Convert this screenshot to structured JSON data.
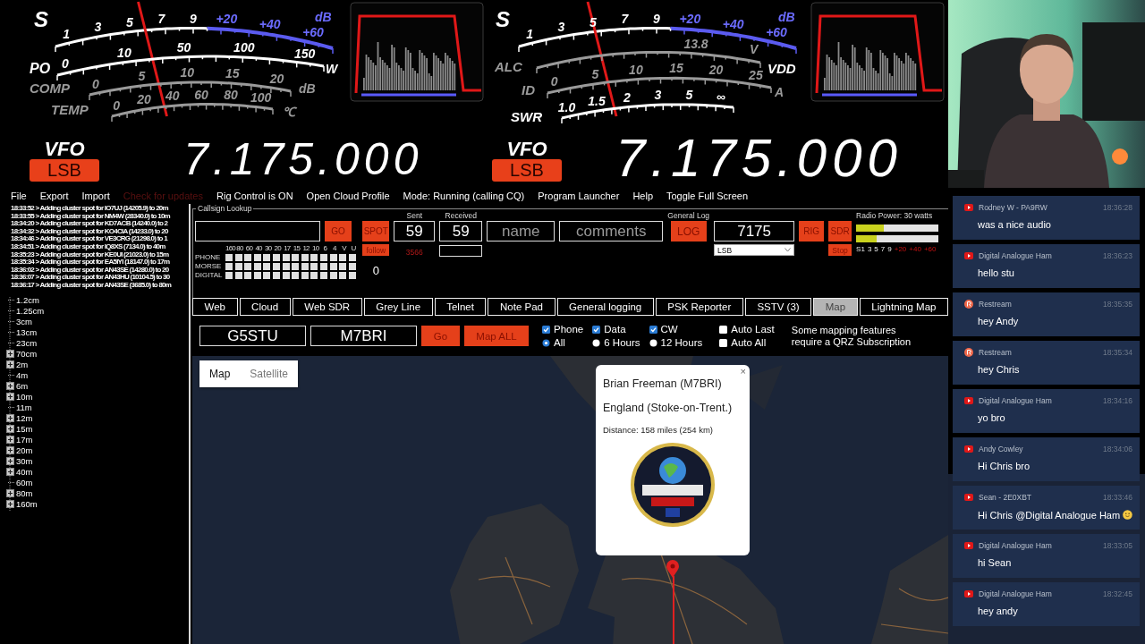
{
  "meters": [
    {
      "level": 0.35,
      "rows": [
        {
          "label": "S",
          "kind": "bright",
          "ticks": [
            "1",
            "3",
            "5",
            "7",
            "9"
          ],
          "over_ticks": [
            "+20",
            "+40",
            "+60"
          ],
          "unit": "dB"
        },
        {
          "label": "PO",
          "kind": "bright",
          "ticks": [
            "0",
            "10",
            "50",
            "100",
            "150"
          ],
          "unit": "W"
        },
        {
          "label": "COMP",
          "kind": "dim",
          "ticks": [
            "0",
            "5",
            "10",
            "15",
            "20"
          ],
          "unit": "dB"
        },
        {
          "label": "TEMP",
          "kind": "dim",
          "ticks": [
            "0",
            "20",
            "40",
            "60",
            "80",
            "100"
          ],
          "unit": "℃"
        }
      ]
    },
    {
      "level": 0.3,
      "rows": [
        {
          "label": "S",
          "kind": "bright",
          "ticks": [
            "1",
            "3",
            "5",
            "7",
            "9"
          ],
          "over_ticks": [
            "+20",
            "+40",
            "+60"
          ],
          "unit": "dB"
        },
        {
          "label": "ALC",
          "kind": "dim",
          "ticks": [
            "13.8"
          ],
          "unit": "V",
          "end_label": "VDD"
        },
        {
          "label": "ID",
          "kind": "dim",
          "ticks": [
            "0",
            "5",
            "10",
            "15",
            "20",
            "25"
          ],
          "unit": "A"
        },
        {
          "label": "SWR",
          "kind": "bright",
          "ticks": [
            "1.0",
            "1.5",
            "2",
            "3",
            "5",
            "∞"
          ]
        }
      ]
    }
  ],
  "vfos": [
    {
      "label": "VFO",
      "mode": "LSB",
      "frequency": "7.175.000",
      "active": false
    },
    {
      "label": "VFO",
      "mode": "LSB",
      "frequency": "7.175.000",
      "active": true
    }
  ],
  "menu": [
    {
      "label": "File",
      "disabled": false
    },
    {
      "label": "Export",
      "disabled": false
    },
    {
      "label": "Import",
      "disabled": false
    },
    {
      "label": "Check for updates",
      "disabled": true
    },
    {
      "label": "Rig Control is ON",
      "disabled": false
    },
    {
      "label": "Open Cloud Profile",
      "disabled": false
    },
    {
      "label": "Mode: Running (calling CQ)",
      "disabled": false
    },
    {
      "label": "Program Launcher",
      "disabled": false
    },
    {
      "label": "Help",
      "disabled": false
    },
    {
      "label": "Toggle Full Screen",
      "disabled": false
    }
  ],
  "cluster_log": [
    "18:33:52 > Adding cluster spot for IO7UJ (14205.9) to 20m",
    "18:33:55 > Adding cluster spot for NM4W (28340.0) to 10m",
    "18:34:20 > Adding cluster spot for KD7ACB (14240.0) to 2",
    "18:34:32 > Adding cluster spot for KO4CIA (14233.0) to 20",
    "18:34:46 > Adding cluster spot for VE3CRG (21298.0) to 1",
    "18:34:51 > Adding cluster spot for IQ8XS (7134.0) to 40m",
    "18:35:23 > Adding cluster spot for KE0UI (21023.0) to 15m",
    "18:35:34 > Adding cluster spot for EA5IYI (18147.0) to 17m",
    "18:36:02 > Adding cluster spot for AN43SE (14280.0) to 20",
    "18:36:07 > Adding cluster spot for AN43HU (10104.5) to 30",
    "18:36:17 > Adding cluster spot for AN43SE (3685.0) to 80m"
  ],
  "lookup": {
    "title": "Callsign Lookup",
    "go": "GO",
    "spot": "SPOT",
    "follow": "follow",
    "count": "3566",
    "qso_count": "0",
    "bands": [
      "160",
      "80",
      "60",
      "40",
      "30",
      "20",
      "17",
      "15",
      "12",
      "10",
      "6",
      "4",
      "V",
      "U"
    ],
    "modes": [
      {
        "label": "PHONE",
        "cells": [
          {
            "checked": false
          },
          {
            "checked": false
          },
          {
            "checked": false
          },
          {
            "checked": false
          },
          {
            "checked": false
          },
          {
            "checked": false
          },
          {
            "checked": false
          },
          {
            "checked": false
          },
          {
            "checked": false
          },
          {
            "checked": false
          },
          {
            "checked": false
          },
          {
            "checked": false
          },
          {
            "checked": false
          },
          {
            "checked": false
          }
        ]
      },
      {
        "label": "MORSE",
        "cells": [
          {
            "checked": false
          },
          {
            "checked": false
          },
          {
            "checked": false
          },
          {
            "checked": false
          },
          {
            "checked": false
          },
          {
            "checked": false
          },
          {
            "checked": false
          },
          {
            "checked": false
          },
          {
            "checked": false
          },
          {
            "checked": false
          },
          {
            "checked": false
          },
          {
            "checked": false
          },
          {
            "checked": false
          },
          {
            "checked": false
          }
        ]
      },
      {
        "label": "DIGITAL",
        "cells": [
          {
            "checked": false
          },
          {
            "checked": false
          },
          {
            "checked": false
          },
          {
            "checked": false
          },
          {
            "checked": false
          },
          {
            "checked": false
          },
          {
            "checked": false
          },
          {
            "checked": false
          },
          {
            "checked": false
          },
          {
            "checked": false
          },
          {
            "checked": false
          },
          {
            "checked": false
          },
          {
            "checked": false
          },
          {
            "checked": false
          }
        ]
      }
    ],
    "sent_label": "Sent",
    "sent": "59",
    "received_label": "Received",
    "received": "59",
    "name_placeholder": "name",
    "comments_placeholder": "comments",
    "log_title": "General Log",
    "log": "LOG",
    "frequency": "7175",
    "mode": "LSB",
    "rig": "RIG",
    "sdr": "SDR",
    "stop": "Stop",
    "power_label": "Radio Power: 30 watts",
    "power_bars": [
      {
        "level": 0.34
      },
      {
        "level": 0.25
      }
    ],
    "power_scale": [
      {
        "label": "S1",
        "kind": "normal"
      },
      {
        "label": "3",
        "kind": "normal"
      },
      {
        "label": "5",
        "kind": "normal"
      },
      {
        "label": "7",
        "kind": "normal"
      },
      {
        "label": "9",
        "kind": "normal"
      },
      {
        "label": "+20",
        "kind": "over"
      },
      {
        "label": "+40",
        "kind": "over"
      },
      {
        "label": "+60",
        "kind": "over"
      }
    ]
  },
  "band_tree": [
    {
      "label": "1.2cm",
      "kind": "leaf"
    },
    {
      "label": "1.25cm",
      "kind": "leaf"
    },
    {
      "label": "3cm",
      "kind": "leaf"
    },
    {
      "label": "13cm",
      "kind": "leaf"
    },
    {
      "label": "23cm",
      "kind": "leaf"
    },
    {
      "label": "70cm",
      "kind": "group"
    },
    {
      "label": "2m",
      "kind": "group"
    },
    {
      "label": "4m",
      "kind": "leaf"
    },
    {
      "label": "6m",
      "kind": "group"
    },
    {
      "label": "10m",
      "kind": "group"
    },
    {
      "label": "11m",
      "kind": "leaf"
    },
    {
      "label": "12m",
      "kind": "group"
    },
    {
      "label": "15m",
      "kind": "group"
    },
    {
      "label": "17m",
      "kind": "group"
    },
    {
      "label": "20m",
      "kind": "group"
    },
    {
      "label": "30m",
      "kind": "group"
    },
    {
      "label": "40m",
      "kind": "group"
    },
    {
      "label": "60m",
      "kind": "leaf"
    },
    {
      "label": "80m",
      "kind": "group"
    },
    {
      "label": "160m",
      "kind": "group"
    }
  ],
  "tabs": [
    {
      "label": "Web",
      "selected": false
    },
    {
      "label": "Cloud",
      "selected": false
    },
    {
      "label": "Web SDR",
      "selected": false
    },
    {
      "label": "Grey Line",
      "selected": false
    },
    {
      "label": "Telnet",
      "selected": false
    },
    {
      "label": "Note Pad",
      "selected": false
    },
    {
      "label": "General logging",
      "selected": false
    },
    {
      "label": "PSK Reporter",
      "selected": false
    },
    {
      "label": "SSTV (3)",
      "selected": false
    },
    {
      "label": "Map",
      "selected": true
    },
    {
      "label": "Lightning Map",
      "selected": false
    }
  ],
  "map_toolbar": {
    "callsigns": [
      "G5STU",
      "M7BRI"
    ],
    "go": "Go",
    "map_all": "Map ALL",
    "filters": [
      {
        "label": "Phone",
        "checked": true
      },
      {
        "label": "Data",
        "checked": true
      },
      {
        "label": "CW",
        "checked": true
      }
    ],
    "ranges": [
      {
        "label": "All",
        "selected": true
      },
      {
        "label": "6 Hours",
        "selected": false
      },
      {
        "label": "12 Hours",
        "selected": false
      }
    ],
    "auto": [
      {
        "label": "Auto Last",
        "checked": false
      },
      {
        "label": "Auto All",
        "checked": false
      }
    ],
    "note": "Some mapping features require a QRZ Subscription"
  },
  "map": {
    "view_toggle": [
      {
        "label": "Map",
        "selected": true
      },
      {
        "label": "Satellite",
        "selected": false
      }
    ],
    "popup": {
      "title": "Brian Freeman (M7BRI)",
      "location": "England (Stoke-on-Trent.)",
      "distance": "Distance: 158 miles (254 km)",
      "close": "×"
    }
  },
  "chat": [
    {
      "kind": "youtube",
      "author": "Rodney W - PA9RW",
      "time": "18:36:28",
      "text": "was a nice audio",
      "emoji": false
    },
    {
      "kind": "youtube",
      "author": "Digital Analogue Ham",
      "time": "18:36:23",
      "text": "hello stu",
      "emoji": false
    },
    {
      "kind": "restream",
      "author": "Restream",
      "time": "18:35:35",
      "text": "hey Andy",
      "emoji": false
    },
    {
      "kind": "restream",
      "author": "Restream",
      "time": "18:35:34",
      "text": "hey Chris",
      "emoji": false
    },
    {
      "kind": "youtube",
      "author": "Digital Analogue Ham",
      "time": "18:34:16",
      "text": "yo bro",
      "emoji": false
    },
    {
      "kind": "youtube",
      "author": "Andy Cowley",
      "time": "18:34:06",
      "text": "Hi Chris bro",
      "emoji": false
    },
    {
      "kind": "youtube",
      "author": "Sean - 2E0XBT",
      "time": "18:33:46",
      "text": "Hi Chris @Digital Analogue Ham",
      "emoji": true
    },
    {
      "kind": "youtube",
      "author": "Digital Analogue Ham",
      "time": "18:33:05",
      "text": "hi Sean",
      "emoji": false
    },
    {
      "kind": "youtube",
      "author": "Digital Analogue Ham",
      "time": "18:32:45",
      "text": "hey andy",
      "emoji": false
    }
  ]
}
